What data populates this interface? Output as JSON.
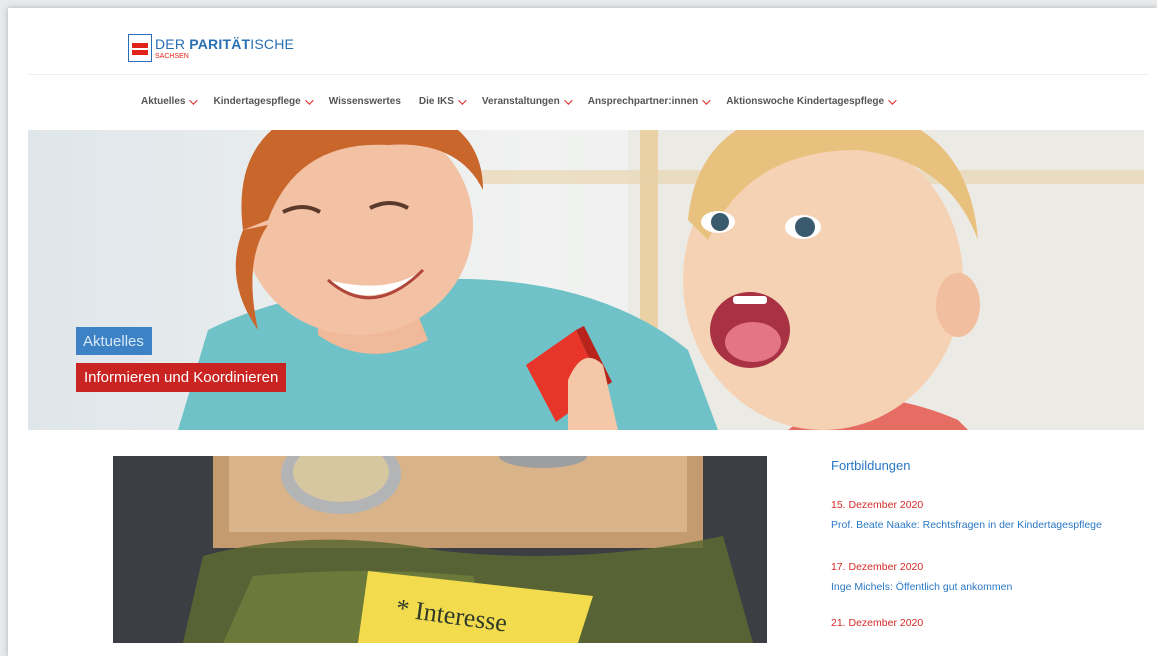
{
  "logo": {
    "prefix": "DER ",
    "brand": "PARITÄT",
    "suffix": "ISCHE",
    "region": "SACHSEN"
  },
  "nav": [
    {
      "label": "Aktuelles",
      "dropdown": true
    },
    {
      "label": "Kindertagespflege",
      "dropdown": true
    },
    {
      "label": "Wissenswertes",
      "dropdown": false
    },
    {
      "label": "Die IKS",
      "dropdown": true
    },
    {
      "label": "Veranstaltungen",
      "dropdown": true
    },
    {
      "label": "Ansprechpartner:innen",
      "dropdown": true
    },
    {
      "label": "Aktionswoche Kindertagespflege",
      "dropdown": true
    }
  ],
  "hero": {
    "category": "Aktuelles",
    "headline": "Informieren und Koordinieren"
  },
  "sidebar": {
    "title": "Fortbildungen",
    "events": [
      {
        "date": "15. Dezember 2020",
        "title": "Prof. Beate Naake: Rechtsfragen in der Kindertagespflege"
      },
      {
        "date": "17. Dezember 2020",
        "title": "Inge Michels: Öffentlich gut ankommen"
      },
      {
        "date": "21. Dezember 2020"
      }
    ]
  },
  "photo_note": "* Interesse",
  "colors": {
    "brand_blue": "#2a78c5",
    "brand_red": "#d32b27",
    "nav_text": "#555555"
  }
}
